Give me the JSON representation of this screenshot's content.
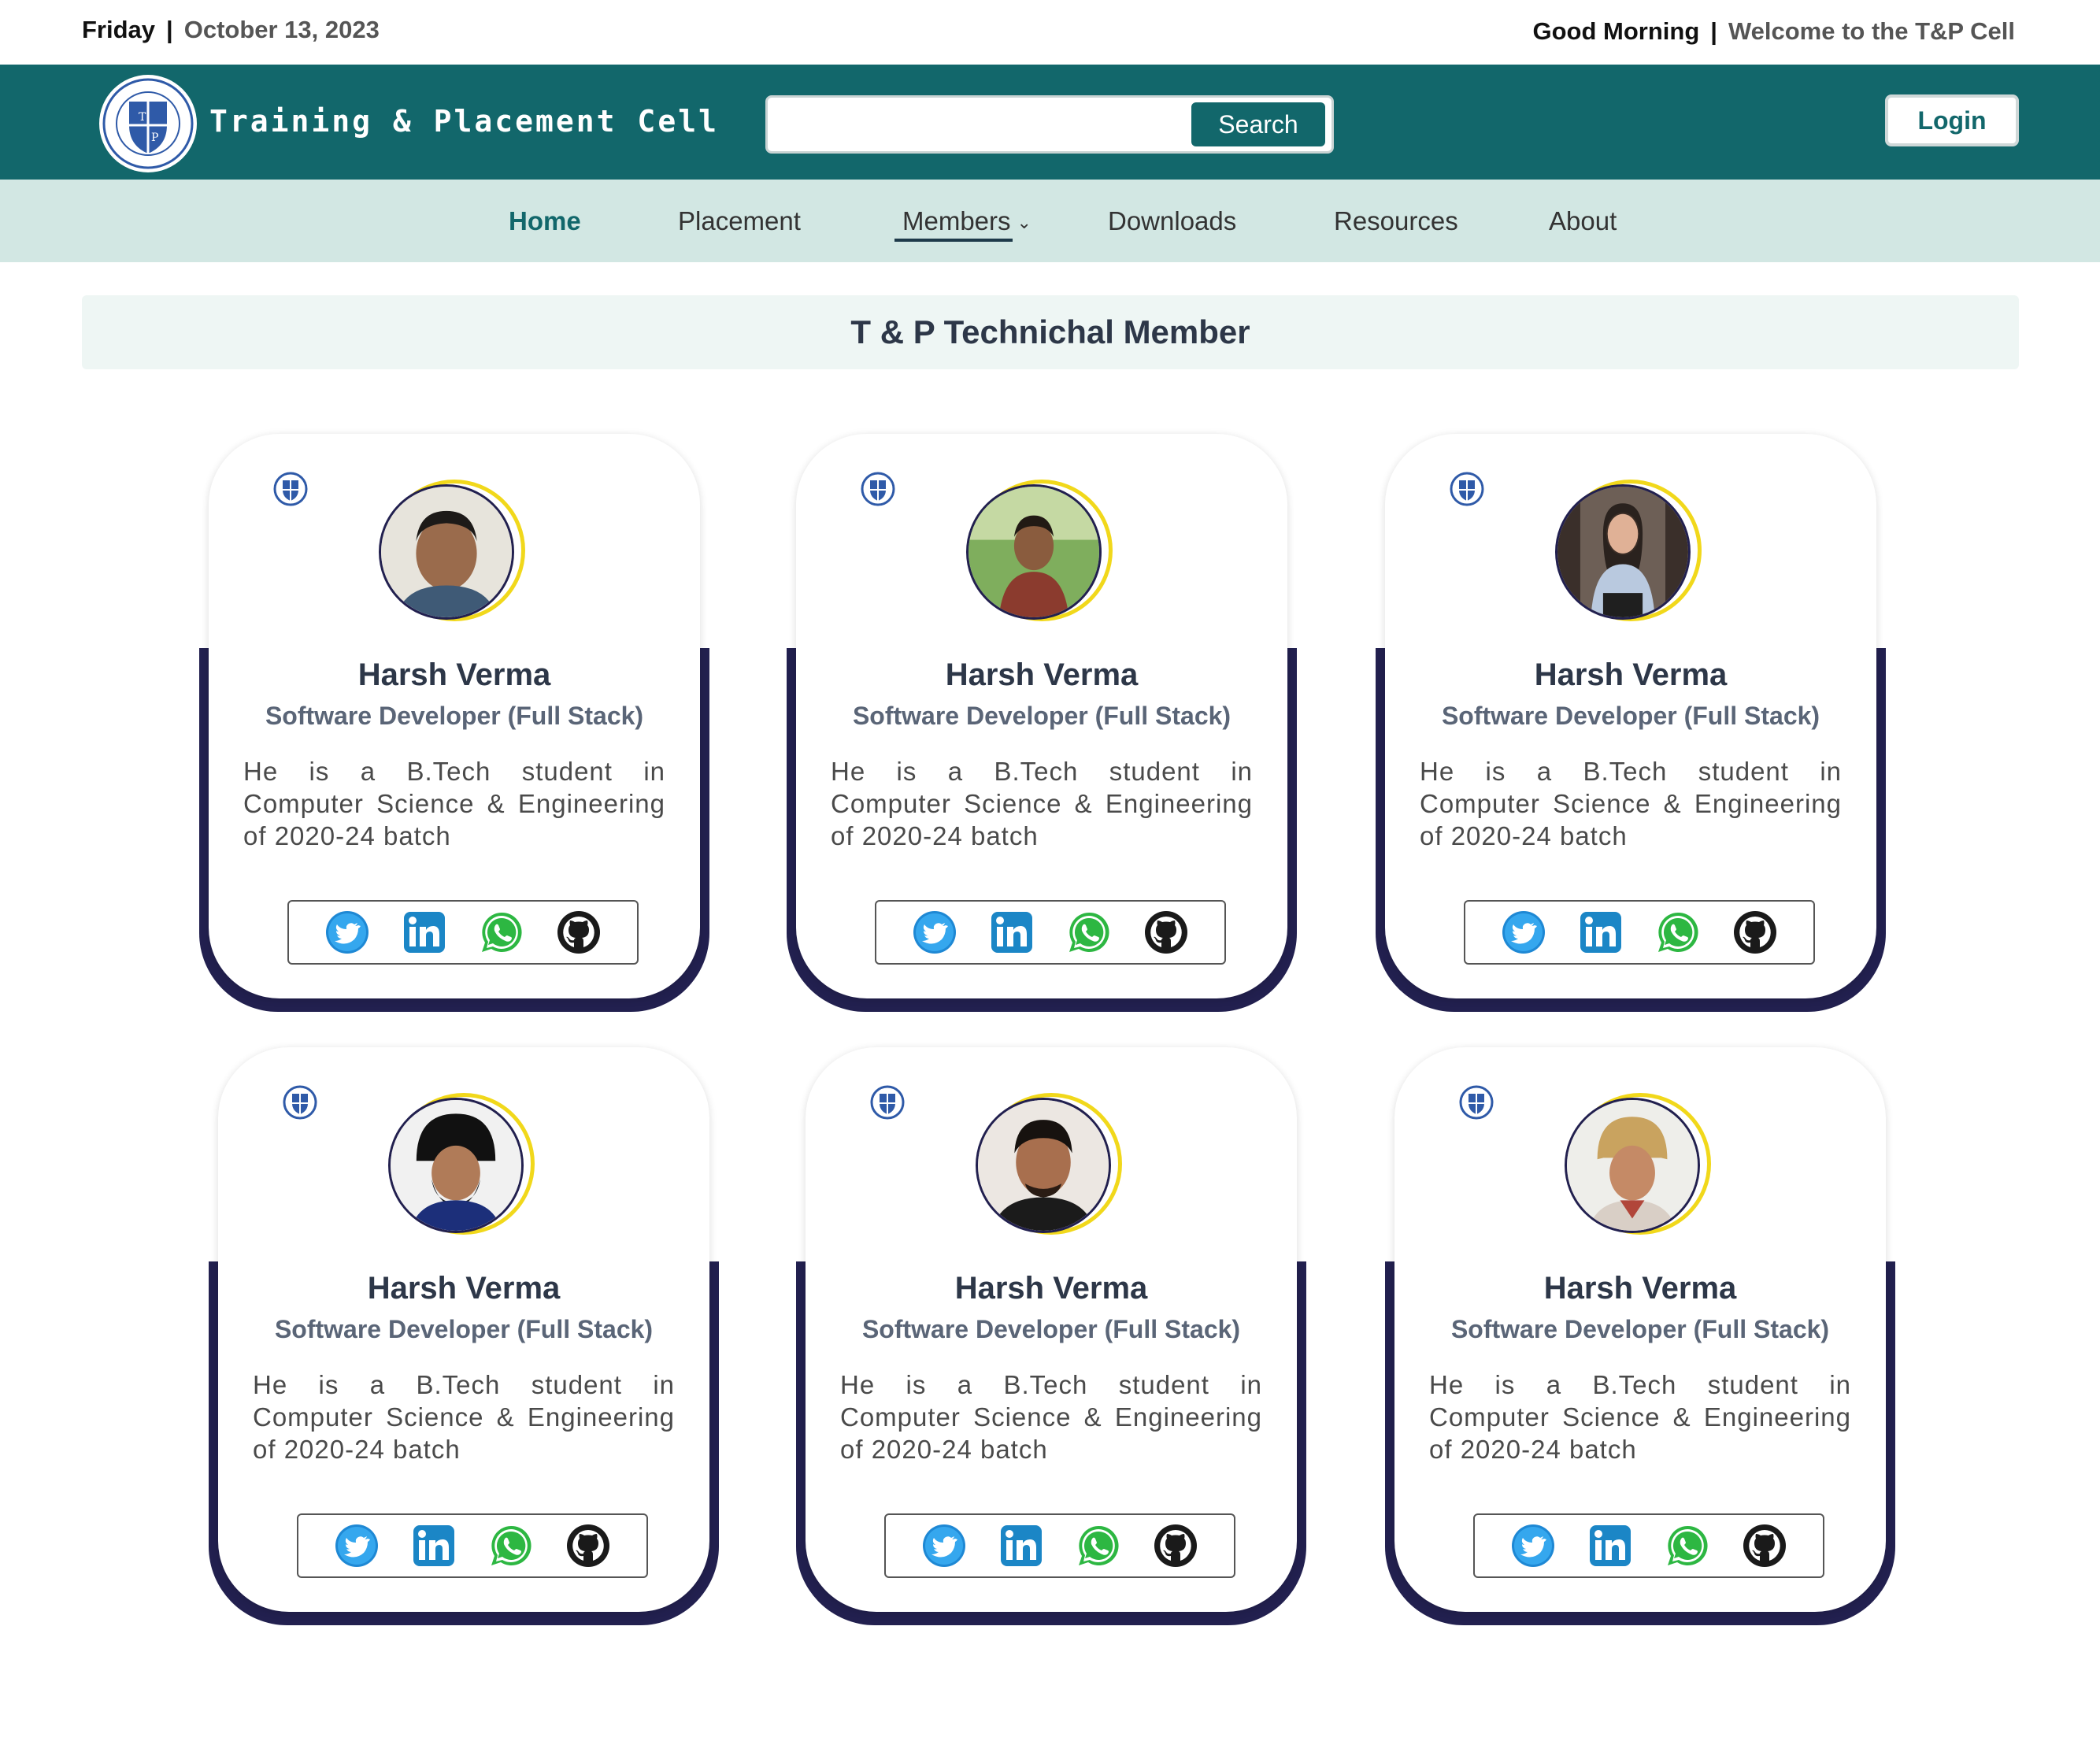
{
  "topbar": {
    "day": "Friday",
    "date": "October 13, 2023",
    "greeting": "Good Morning",
    "welcome": "Welcome to the T&P Cell"
  },
  "header": {
    "brand": "Training & Placement Cell",
    "search_placeholder": "",
    "search_button": "Search",
    "login_button": "Login"
  },
  "nav": {
    "items": [
      "Home",
      "Placement",
      "Members",
      "Downloads",
      "Resources",
      "About"
    ],
    "active": "Home"
  },
  "section": {
    "title": "T & P Technichal Member"
  },
  "members": [
    {
      "name": "Harsh Verma",
      "role": "Software Developer (Full Stack)",
      "bio": "He is a B.Tech student in Computer Science & Engineering of 2020-24 batch"
    },
    {
      "name": "Harsh Verma",
      "role": "Software Developer (Full Stack)",
      "bio": "He is a B.Tech student in Computer Science & Engineering of 2020-24 batch"
    },
    {
      "name": "Harsh Verma",
      "role": "Software Developer (Full Stack)",
      "bio": "He is a B.Tech student in Computer Science & Engineering of 2020-24 batch"
    },
    {
      "name": "Harsh Verma",
      "role": "Software Developer (Full Stack)",
      "bio": "He is a B.Tech student in Computer Science & Engineering of 2020-24 batch"
    },
    {
      "name": "Harsh Verma",
      "role": "Software Developer (Full Stack)",
      "bio": "He is a B.Tech student in Computer Science & Engineering of 2020-24 batch"
    },
    {
      "name": "Harsh Verma",
      "role": "Software Developer (Full Stack)",
      "bio": "He is a B.Tech student in Computer Science & Engineering of 2020-24 batch"
    }
  ],
  "social_icons": [
    "twitter-icon",
    "linkedin-icon",
    "whatsapp-icon",
    "github-icon"
  ],
  "colors": {
    "header": "#12676b",
    "nav": "#d2e7e3",
    "card_base": "#22204f",
    "avatar_ring": "#f1d81b"
  }
}
